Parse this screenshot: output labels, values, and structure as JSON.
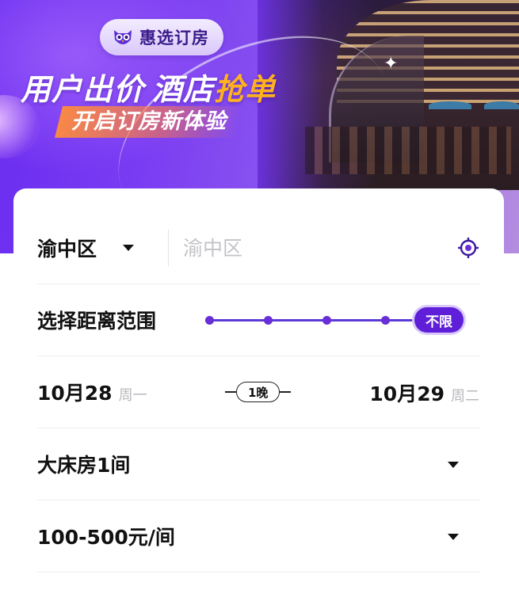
{
  "banner": {
    "brand": "惠选订房",
    "headline_part1": "用户出价",
    "headline_part2": "酒店",
    "headline_highlight": "抢单",
    "subline": "开启订房新体验",
    "highlight_color": "#ffb21e",
    "icons": [
      "owl-icon",
      "sparkle-icon"
    ]
  },
  "location": {
    "district": "渝中区",
    "search_placeholder": "渝中区",
    "locate_icon": "locate-icon"
  },
  "distance": {
    "label": "选择距离范围",
    "selected": "不限",
    "steps": 5
  },
  "dates": {
    "checkin": "10月28",
    "checkin_weekday": "周一",
    "nights": "1晚",
    "checkout": "10月29",
    "checkout_weekday": "周二"
  },
  "room": {
    "value": "大床房1间"
  },
  "price": {
    "value": "100-500元/间"
  },
  "colors": {
    "accent": "#5f1fd8",
    "banner_start": "#6a2cf0",
    "text_primary": "#111111",
    "text_muted": "#b8b8bd"
  }
}
